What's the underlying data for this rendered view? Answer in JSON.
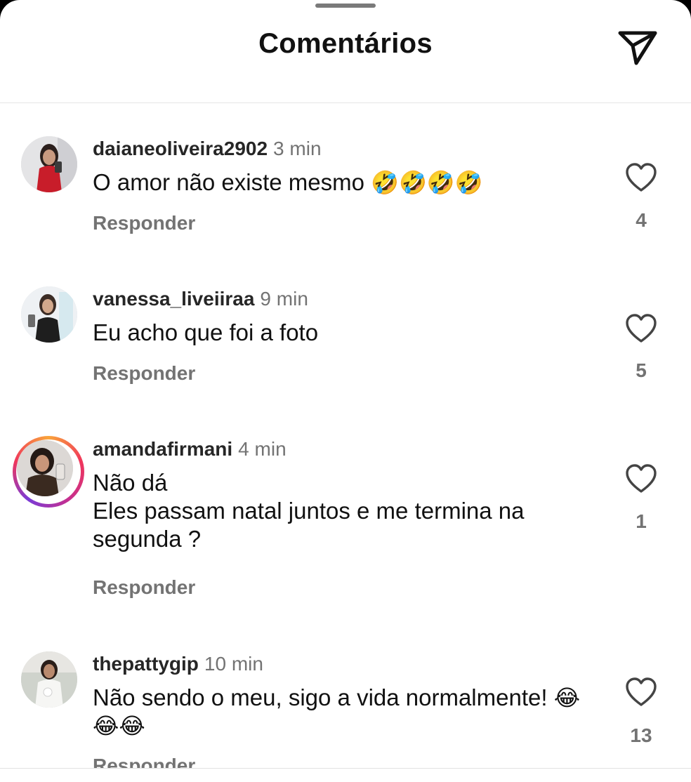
{
  "header": {
    "title": "Comentários",
    "share_icon": "paper-plane-icon"
  },
  "comments": [
    {
      "username": "daianeoliveira2902",
      "time": "3 min",
      "text": "O amor não existe mesmo",
      "emoji": "🤣🤣🤣🤣",
      "reply_label": "Responder",
      "likes": "4"
    },
    {
      "username": "vanessa_liveiiraa",
      "time": "9 min",
      "text": "Eu acho que foi a foto",
      "emoji": "",
      "reply_label": "Responder",
      "likes": "5"
    },
    {
      "username": "amandafirmani",
      "time": "4 min",
      "text": "Não dá\nEles passam natal juntos e me termina na segunda ?",
      "emoji": "",
      "reply_label": "Responder",
      "likes": "1",
      "has_story_ring": true
    },
    {
      "username": "thepattygip",
      "time": "10 min",
      "text": "Não sendo o meu, sigo a vida normalmente!",
      "emoji": "😂😂😂",
      "reply_label": "Responder",
      "likes": "13"
    }
  ],
  "colors": {
    "text_primary": "#111111",
    "text_secondary": "#737373",
    "story_ring": [
      "#f9a43a",
      "#f0365b",
      "#c62f8f"
    ]
  }
}
